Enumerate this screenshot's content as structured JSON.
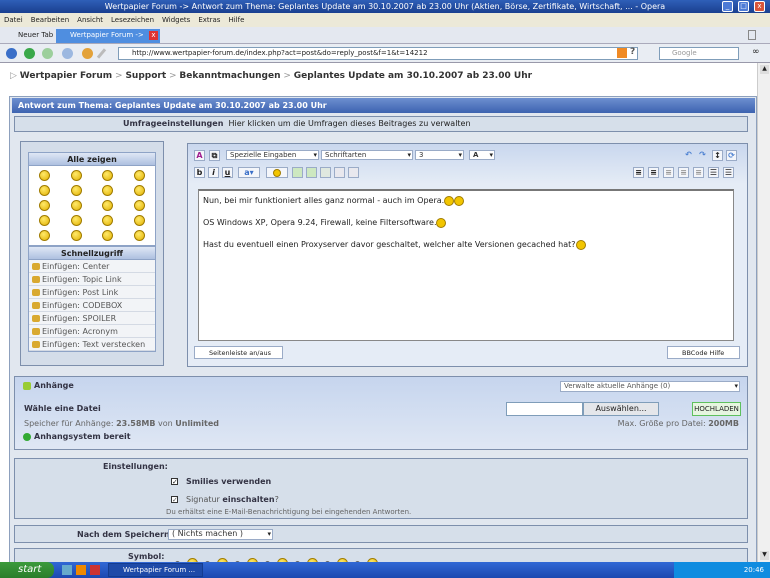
{
  "window": {
    "title": "Wertpapier Forum -> Antwort zum Thema: Geplantes Update am 30.10.2007 ab 23.00 Uhr (Aktien, Börse, Zertifikate, Wirtschaft, ... - Opera"
  },
  "menu": [
    "Datei",
    "Bearbeiten",
    "Ansicht",
    "Lesezeichen",
    "Widgets",
    "Extras",
    "Hilfe"
  ],
  "tabs": [
    {
      "label": "Neuer Tab"
    },
    {
      "label": "Wertpapier Forum -> An..."
    }
  ],
  "address": {
    "url": "http://www.wertpapier-forum.de/index.php?act=post&do=reply_post&f=1&t=14212",
    "search_placeholder": "Google"
  },
  "breadcrumb": [
    "Wertpapier Forum",
    "Support",
    "Bekanntmachungen",
    "Geplantes Update am 30.10.2007 ab 23.00 Uhr"
  ],
  "form": {
    "header": "Antwort zum Thema: Geplantes Update am 30.10.2007 ab 23.00 Uhr",
    "poll_label": "Umfrageeinstellungen",
    "poll_link": "Hier klicken um die Umfragen dieses Beitrages zu verwalten",
    "smilies_title": "Alle zeigen",
    "quick_title": "Schnellzugriff",
    "quick_items": [
      "Einfügen: Center",
      "Einfügen: Topic Link",
      "Einfügen: Post Link",
      "Einfügen: CODEBOX",
      "Einfügen: SPOILER",
      "Einfügen: Acronym",
      "Einfügen: Text verstecken"
    ],
    "editor": {
      "special": "Spezielle Eingaben",
      "fonts": "Schriftarten",
      "size": "3",
      "color": "A",
      "bold": "b",
      "italic": "i",
      "underline": "u",
      "lines": [
        "Nun, bei mir funktioniert alles ganz normal - auch im Opera.",
        "OS Windows XP, Opera 9.24, Firewall, keine Filtersoftware.",
        "Hast du eventuell einen Proxyserver davor geschaltet, welcher alte Versionen gecached hat?"
      ],
      "sidebar_toggle": "Seitenleiste an/aus",
      "bbcode_help": "BBCode Hilfe"
    },
    "attachments": {
      "title": "Anhänge",
      "manage": "Verwalte aktuelle Anhänge (0)",
      "choose": "Wähle eine Datei",
      "browse": "Auswählen...",
      "upload": "HOCHLADEN",
      "storage_prefix": "Speicher für Anhänge:",
      "storage_used": "23.58MB",
      "storage_of": "von",
      "storage_total": "Unlimited",
      "max_prefix": "Max. Größe pro Datei:",
      "max_size": "200MB",
      "status": "Anhangsystem bereit"
    },
    "settings": {
      "label": "Einstellungen:",
      "smilies": "Smilies verwenden",
      "sig_prefix": "Signatur",
      "sig_bold": "einschalten",
      "sig_suffix": "?",
      "email_note": "Du erhältst eine E-Mail-Benachrichtigung bei eingehenden Antworten."
    },
    "after_save": {
      "label": "Nach dem Speichern:",
      "value": "( Nichts machen )"
    },
    "symbol": {
      "label": "Symbol:"
    }
  },
  "taskbar": {
    "start": "start",
    "task": "Wertpapier Forum ...",
    "time": "20:46"
  }
}
